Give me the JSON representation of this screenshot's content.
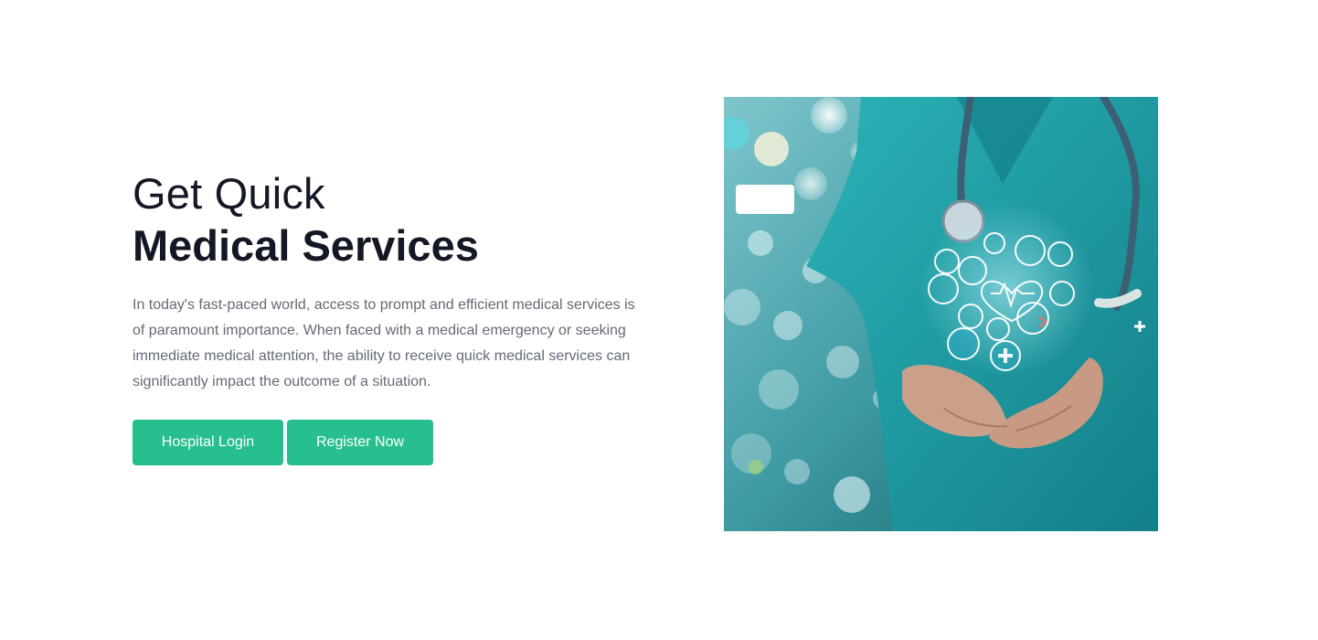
{
  "hero": {
    "title_line1": "Get Quick",
    "title_line2": "Medical Services",
    "description": "In today's fast-paced world, access to prompt and efficient medical services is of paramount importance. When faced with a medical emergency or seeking immediate medical attention, the ability to receive quick medical services can significantly impact the outcome of a situation."
  },
  "buttons": {
    "login_label": "Hospital Login",
    "register_label": "Register Now"
  },
  "colors": {
    "accent": "#27bf8f",
    "heading": "#141824",
    "body_text": "#636a74",
    "scrubs": "#1fa7ad"
  },
  "image": {
    "icons": [
      "heart-icon",
      "stethoscope-icon",
      "plus-icon",
      "ecg-icon",
      "lock-icon",
      "syringe-icon"
    ]
  }
}
